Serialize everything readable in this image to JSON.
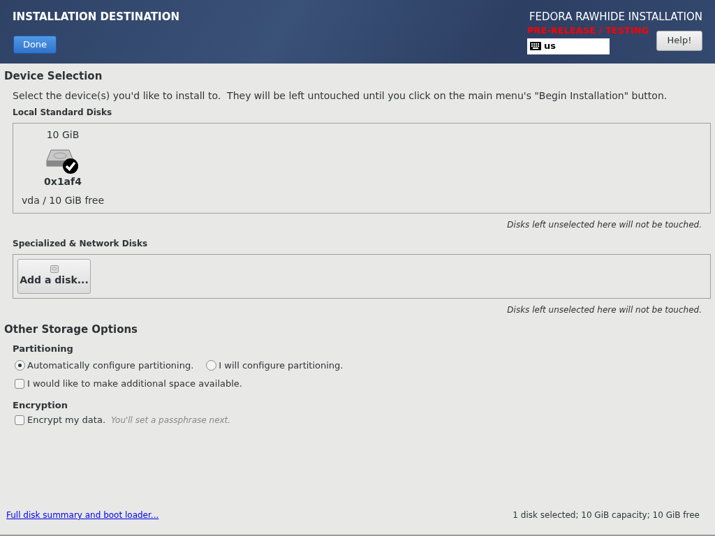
{
  "header": {
    "title": "INSTALLATION DESTINATION",
    "done_button": "Done",
    "product": "FEDORA RAWHIDE INSTALLATION",
    "prerelease": "PRE-RELEASE / TESTING",
    "keyboard_layout": "us",
    "help_button": "Help!"
  },
  "device_selection": {
    "heading": "Device Selection",
    "instruction": "Select the device(s) you'd like to install to.  They will be left untouched until you click on the main menu's \"Begin Installation\" button.",
    "local_disks": {
      "heading": "Local Standard Disks",
      "disks": [
        {
          "size": "10 GiB",
          "name": "0x1af4",
          "detail": "vda / 10 GiB free",
          "selected": true
        }
      ],
      "note": "Disks left unselected here will not be touched."
    },
    "specialized_disks": {
      "heading": "Specialized & Network Disks",
      "add_button": "Add a disk...",
      "note": "Disks left unselected here will not be touched."
    }
  },
  "other_storage": {
    "heading": "Other Storage Options",
    "partitioning": {
      "heading": "Partitioning",
      "options": [
        {
          "label": "Automatically configure partitioning.",
          "selected": true
        },
        {
          "label": "I will configure partitioning.",
          "selected": false
        }
      ],
      "additional_space": {
        "label": "I would like to make additional space available.",
        "checked": false
      }
    },
    "encryption": {
      "heading": "Encryption",
      "encrypt": {
        "label": "Encrypt my data.",
        "hint": "You'll set a passphrase next.",
        "checked": false
      }
    }
  },
  "footer": {
    "link": "Full disk summary and boot loader...",
    "summary": "1 disk selected; 10 GiB capacity; 10 GiB free"
  }
}
